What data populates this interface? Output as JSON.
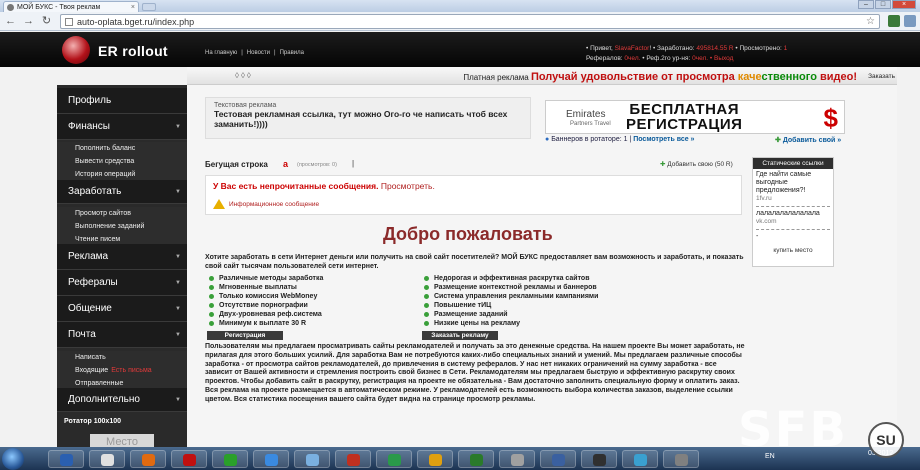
{
  "browser": {
    "tab_title": "МОЙ БУКС - Твоя реклам",
    "url": "auto-oplata.bget.ru/index.php"
  },
  "site": {
    "logo_text": "ER rollout",
    "nav": [
      "На главную",
      "|",
      "Новости",
      "|",
      "Правила"
    ],
    "user": {
      "greet_label": "• Привет,",
      "name": "SlavaFactor",
      "earned_label": "• Заработано:",
      "earned": "495814.55 R",
      "viewed_label": "• Просмотрено:",
      "viewed": "1",
      "refs_label": "Рефералов:",
      "refs": "0чел.",
      "ref2_label": "• Реф.2го ур-ня:",
      "ref2": "0чел.",
      "exit": "• Выход"
    },
    "ticker": {
      "dots": "◊◊◊",
      "label": "Платная реклама",
      "t1": "Получай удовольствие от просмотра ",
      "t2": "каче",
      "t3": "ственного",
      "t4": " видео!",
      "order": "Заказать"
    }
  },
  "sidebar": {
    "profile": "Профиль",
    "finance": "Финансы",
    "finance_items": [
      "Пополнить баланс",
      "Вывести средства",
      "История операций"
    ],
    "earn": "Заработать",
    "earn_items": [
      "Просмотр сайтов",
      "Выполнение заданий",
      "Чтение писем"
    ],
    "ads": "Реклама",
    "refs": "Рефералы",
    "chat": "Общение",
    "mail": "Почта",
    "mail_items": [
      "Написать",
      "Входящие",
      "Отправленные"
    ],
    "inbox_note": "Есть письма",
    "more": "Дополнительно",
    "banner_label": "Ротатор 100x100",
    "place": "Место"
  },
  "textad": {
    "heading": "Текстовая реклама",
    "body": "Тестовая рекламная ссылка, тут можно Ого-го че написать чтоб всех заманить!))))"
  },
  "banner": {
    "brand": "Emirates",
    "brand2": "Partners Travel",
    "line1": "БЕСПЛАТНАЯ",
    "line2": "РЕГИСТРАЦИЯ",
    "dollar": "$",
    "stat_label": "Баннеров в ротаторе: 1 |",
    "stat_link": "Посмотреть все »",
    "add": "Добавить свой »"
  },
  "running": {
    "label": "Бегущая строка",
    "a": "a",
    "count": "(просмотров: 0)",
    "add": "Добавить свою (50 R)"
  },
  "messages": {
    "text": "У Вас есть непрочитанные сообщения.",
    "link": "Просмотреть.",
    "info": "Информационное сообщение"
  },
  "static_links": {
    "header": "Статические ссылки",
    "items": [
      {
        "title": "Где найти самые выгодные предложения?!",
        "url": "1fv.ru"
      },
      {
        "title": "лалалалалалалала",
        "url": "vk.com"
      }
    ],
    "dash": "-",
    "buy": "купить место"
  },
  "welcome": {
    "title": "Добро пожаловать",
    "intro": "Хотите заработать в сети Интернет деньги или получить на свой сайт посетителей? МОЙ БУКС предоставляет вам возможность и заработать, и показать свой сайт тысячам пользователей сети интернет.",
    "left_features": [
      "Различные методы заработка",
      "Мгновенные выплаты",
      "Только комиссия WebMoney",
      "Отсутствие порнографии",
      "Двух-уровневая реф.система",
      "Минимум к выплате 30 R"
    ],
    "right_features": [
      "Недорогая и эффективная раскрутка сайтов",
      "Размещение контекстной рекламы и баннеров",
      "Система управления рекламными кампаниями",
      "Повышение тИЦ",
      "Размещение заданий",
      "Низкие цены на рекламу"
    ],
    "btn_register": "Регистрация",
    "btn_order": "Заказать рекламу",
    "paragraph": "Пользователям мы предлагаем просматривать сайты рекламодателей и получать за это денежные средства. На нашем проекте Вы может заработать, не прилагая для этого больших усилий. Для заработка Вам не потребуются каких-либо специальных знаний и умений. Мы предлагаем различные способы заработка - от просмотра сайтов рекламодателей, до привлечения в систему рефералов. У нас нет никаких ограничений на сумму заработка - все зависит от Вашей активности и стремления построить свой бизнес в Сети. Рекламодателям мы предлагаем быструю и эффективную раскрутку своих проектов. Чтобы добавить сайт в раскрутку, регистрация на проекте не обязательна - Вам достаточно заполнить специальную форму и оплатить заказ. Вся реклама на проекте размещается в автоматическом режиме. У рекламодателей есть возможность выбора количества заказов, выделение ссылки цветом. Вся статистика посещения вашего сайта будет видна на странице просмотр рекламы."
  },
  "taskbar": {
    "lang": "EN",
    "clock": "03.2012",
    "icon_colors": [
      "#2a5fb0",
      "#e0e0e0",
      "#e06a10",
      "#c01010",
      "#2aa02a",
      "#3a8ae0",
      "#7ab0e0",
      "#c03020",
      "#2a9a4a",
      "#e0a010",
      "#2a7a2a",
      "#a0a0a0",
      "#3a60a0",
      "#303030",
      "#3aa0d0",
      "#808080"
    ]
  },
  "watermark": {
    "text": "SFB",
    "badge": "SU"
  }
}
